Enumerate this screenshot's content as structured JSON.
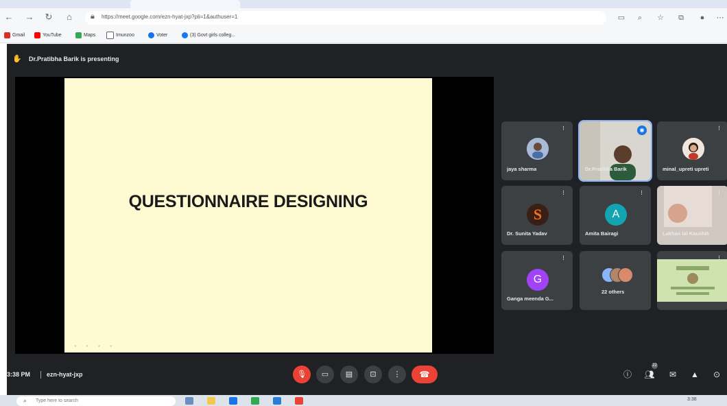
{
  "browser": {
    "url": "https://meet.google.com/ezn-hyat-jxp?pli=1&authuser=1",
    "bookmarks": [
      {
        "label": "Gmail",
        "color": "#d93025"
      },
      {
        "label": "YouTube",
        "color": "#ff0000"
      },
      {
        "label": "Maps",
        "color": "#34a853"
      },
      {
        "label": "Imunzoo",
        "color": "#5f6368"
      },
      {
        "label": "Voter",
        "color": "#1a73e8"
      },
      {
        "label": "(3) Govt girls colleg...",
        "color": "#1877f2"
      }
    ]
  },
  "meet": {
    "presenting_text": "Dr.Pratibha Barik is presenting",
    "slide": {
      "title": "QUESTIONNAIRE DESIGNING"
    },
    "participants": [
      {
        "name": "jaya sharma",
        "avatar": "photo",
        "color": "#7b8fb5"
      },
      {
        "name": "Dr.Pratibha Barik",
        "avatar": "video",
        "speaking": true
      },
      {
        "name": "minal_upreti upreti",
        "avatar": "photo",
        "color": "#c9a48c"
      },
      {
        "name": "Dr. Sunita Yadav",
        "avatar": "S",
        "color": "#3a1f14",
        "letter_color": "#f2711c"
      },
      {
        "name": "Amita Bairagi",
        "avatar": "A",
        "color": "#12a4b0"
      },
      {
        "name": "Lakhan lal Kaushik",
        "avatar": "video"
      },
      {
        "name": "Ganga meenda G...",
        "avatar": "G",
        "color": "#a142f4"
      },
      {
        "name": "22 others",
        "avatar": "group"
      },
      {
        "name": "",
        "avatar": "video"
      }
    ],
    "time": "3:38 PM",
    "meeting_code": "ezn-hyat-jxp",
    "participant_count": "22",
    "accent": "#ea4335"
  },
  "taskbar": {
    "search_placeholder": "Type here to search",
    "time": "3:38"
  }
}
